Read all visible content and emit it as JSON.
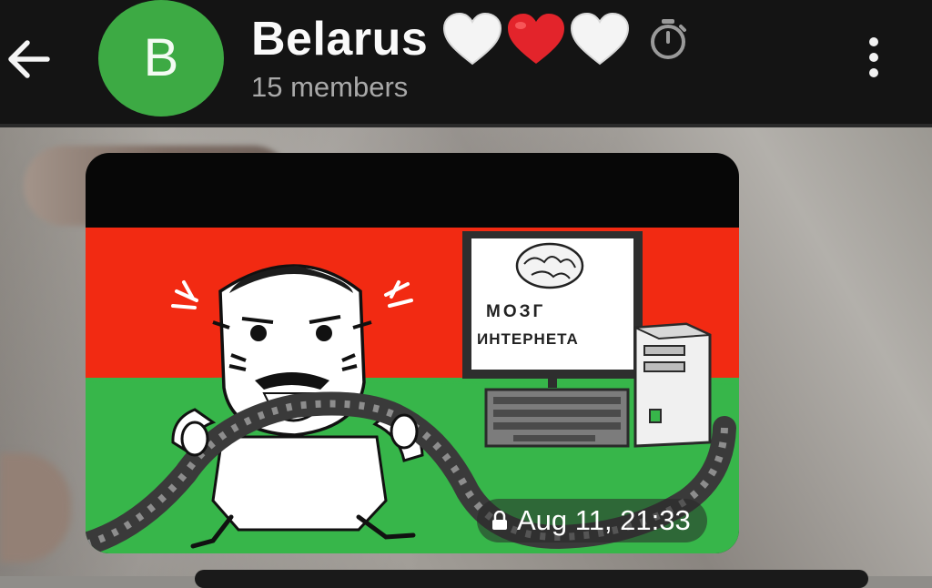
{
  "header": {
    "back_icon": "arrow-left-icon",
    "avatar_letter": "B",
    "avatar_color": "#3daa44",
    "title": "Belarus",
    "title_emoji": [
      "white-heart-icon",
      "red-heart-icon",
      "white-heart-icon"
    ],
    "timer_icon": "stopwatch-icon",
    "subtitle": "15 members",
    "menu_icon": "more-vertical-icon"
  },
  "message": {
    "media": "cartoon-image",
    "artwork_text": [
      "МОЗГ",
      "ИНТЕРНЕТА"
    ],
    "timestamp": "Aug 11, 21:33",
    "lock_icon": "lock-icon"
  },
  "colors": {
    "bar_background": "#141414",
    "flag_red": "#f22a12",
    "flag_green": "#37b64a"
  }
}
